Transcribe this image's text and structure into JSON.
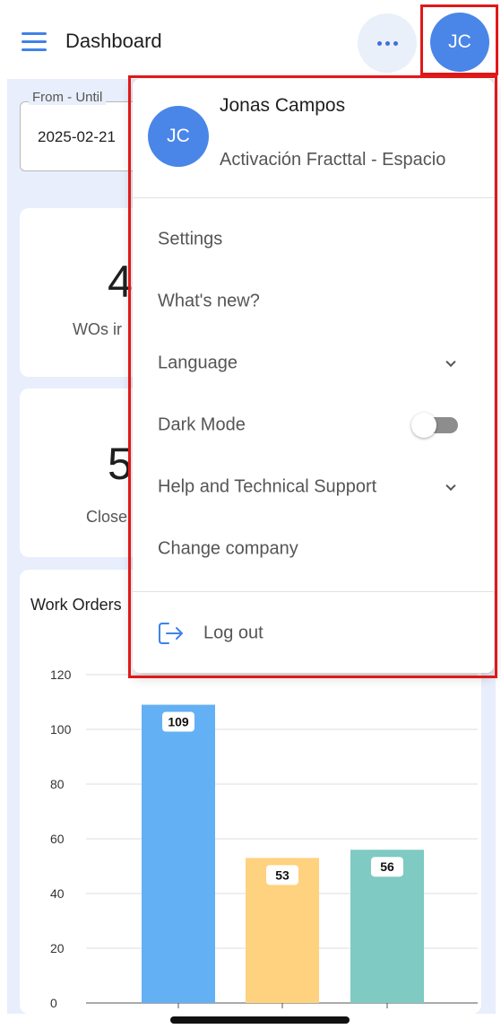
{
  "header": {
    "title": "Dashboard",
    "avatar_initials": "JC",
    "more_icon": "more-horizontal-icon",
    "menu_icon": "hamburger-menu-icon"
  },
  "filters": {
    "date_label": "From - Until",
    "date_value": "2025-02-21"
  },
  "stats": [
    {
      "value": "4",
      "label": "WOs ir"
    },
    {
      "value": "5",
      "label": "Close"
    }
  ],
  "chart": {
    "title": "Work Orders"
  },
  "chart_data": {
    "type": "bar",
    "categories": [
      "",
      "",
      ""
    ],
    "values": [
      109,
      53,
      56
    ],
    "ylim": [
      0,
      120
    ],
    "yticks": [
      0,
      20,
      40,
      60,
      80,
      100,
      120
    ],
    "colors": [
      "#64b0f5",
      "#ffd280",
      "#7fcac3"
    ],
    "grid": true,
    "data_labels": true
  },
  "user_menu": {
    "avatar_initials": "JC",
    "user_name": "Jonas Campos",
    "company": "Activación Fracttal - Espacio",
    "items": [
      {
        "label": "Settings",
        "type": "link"
      },
      {
        "label": "What's new?",
        "type": "link"
      },
      {
        "label": "Language",
        "type": "expand"
      },
      {
        "label": "Dark Mode",
        "type": "toggle",
        "toggle_on": false
      },
      {
        "label": "Help and Technical Support",
        "type": "expand"
      },
      {
        "label": "Change company",
        "type": "link"
      }
    ],
    "logout": {
      "label": "Log out",
      "icon": "logout-icon"
    }
  },
  "colors": {
    "accent": "#4a86e8",
    "highlight": "#e01919",
    "background_area": "#e8eefb"
  }
}
